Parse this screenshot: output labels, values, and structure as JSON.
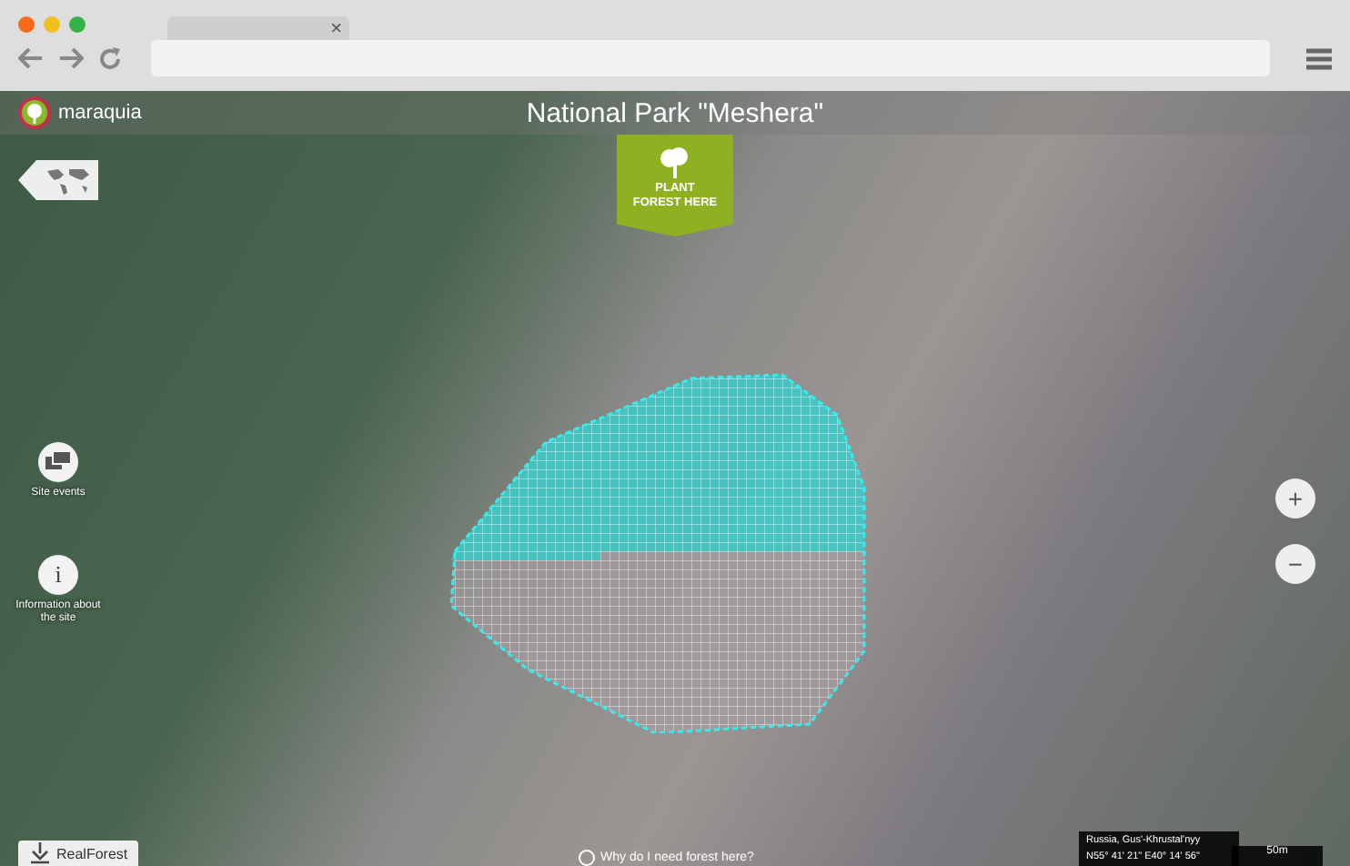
{
  "browser": {
    "tab_close": "×"
  },
  "app": {
    "logo_text": "maraquia",
    "title": "National Park \"Meshera\"",
    "plant_button": "PLANT\nFOREST HERE"
  },
  "side_buttons": [
    {
      "kind": "events",
      "label": "Site events"
    },
    {
      "kind": "info",
      "glyph": "i",
      "label": "Information about the site"
    }
  ],
  "zoom": {
    "plus": "+",
    "minus": "−"
  },
  "footer": {
    "brand": "RealForest",
    "question": "Why do I need forest here?",
    "location": "Russia, Gus'-Khrustal'nyy",
    "coords": "N55° 41' 21\" E40° 14' 56\"",
    "scale": "50m"
  }
}
